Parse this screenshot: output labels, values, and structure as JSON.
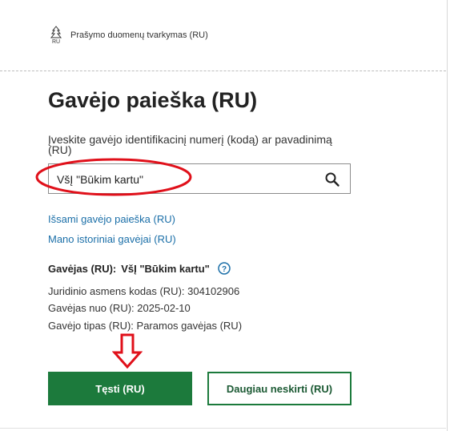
{
  "header": {
    "logo_text": "RU",
    "title": "Prašymo duomenų tvarkymas (RU)"
  },
  "page": {
    "title": "Gavėjo paieška (RU)"
  },
  "search": {
    "label": "Įveskite gavėjo identifikacinį numerį (kodą) ar pavadinimą (RU)",
    "value": "VšĮ \"Būkim kartu\""
  },
  "links": {
    "detailed_search": "Išsami gavėjo paieška (RU)",
    "history": "Mano istoriniai gavėjai (RU)"
  },
  "recipient": {
    "label": "Gavėjas (RU):",
    "name": "VšĮ \"Būkim kartu\"",
    "details": [
      "Juridinio asmens kodas (RU): 304102906",
      "Gavėjas nuo (RU): 2025-02-10",
      "Gavėjo tipas (RU): Paramos gavėjas (RU)"
    ]
  },
  "buttons": {
    "continue": "Tęsti (RU)",
    "no_more": "Daugiau neskirti (RU)"
  },
  "colors": {
    "primary_green": "#1c7a3c",
    "link_blue": "#1b6fa8",
    "annotation_red": "#e0101a"
  }
}
